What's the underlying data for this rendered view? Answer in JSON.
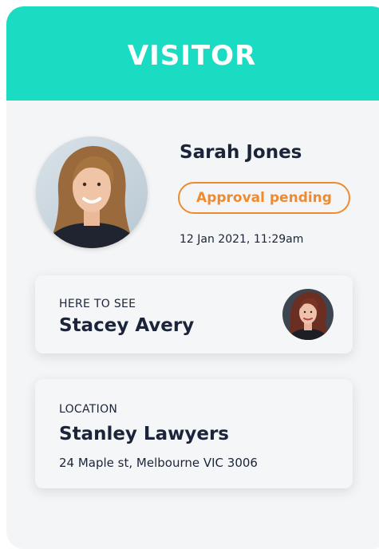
{
  "header": {
    "title": "VISITOR",
    "color": "#19dcc3"
  },
  "visitor": {
    "name": "Sarah Jones",
    "status": "Approval pending",
    "status_color": "#f08a2e",
    "timestamp": "12 Jan 2021, 11:29am",
    "avatar_icon": "woman-portrait-photo"
  },
  "host": {
    "label": "HERE TO SEE",
    "name": "Stacey Avery",
    "avatar_icon": "woman-portrait-photo"
  },
  "location": {
    "label": "LOCATION",
    "name": "Stanley Lawyers",
    "address": "24 Maple st, Melbourne VIC 3006"
  }
}
